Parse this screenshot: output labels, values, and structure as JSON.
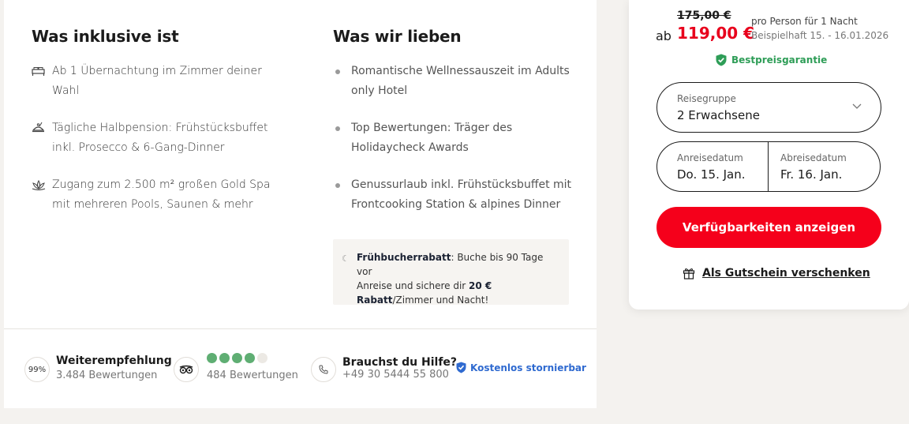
{
  "inclusive": {
    "title": "Was inklusive ist",
    "items": [
      {
        "icon": "bed-icon",
        "text_line1": "Ab 1 Übernachtung im Zimmer deiner",
        "text_line2": "Wahl"
      },
      {
        "icon": "dining-icon",
        "text_line1": "Tägliche Halbpension: Frühstücksbuffet",
        "text_line2": "inkl. Prosecco & 6-Gang-Dinner"
      },
      {
        "icon": "lotus-icon",
        "text_line1": "Zugang zum 2.500 m² großen Gold Spa",
        "text_line2": "mit mehreren Pools, Saunen & mehr"
      }
    ]
  },
  "love": {
    "title": "Was wir lieben",
    "items": [
      {
        "text_line1": "Romantische Wellnessauszeit im Adults",
        "text_line2": "only Hotel"
      },
      {
        "text_line1": "Top Bewertungen: Träger des",
        "text_line2": "Holidaycheck Awards"
      },
      {
        "text_line1": "Genussurlaub inkl. Frühstücksbuffet mit",
        "text_line2": "Frontcooking Station & alpines Dinner"
      }
    ]
  },
  "promo": {
    "bold_prefix": "Frühbucherrabatt",
    "text1": ": Buche bis 90 Tage vor",
    "text2": "Anreise und sichere dir",
    "amount": "20 €",
    "bold_rabatt": "Rabatt",
    "text3": "/Zimmer und Nacht!"
  },
  "ratings": {
    "recommend_badge": "99%",
    "recommend_title": "Weiterempfehlung",
    "recommend_sub": "3.484 Bewertungen",
    "tripadvisor_score": 4,
    "tripadvisor_max": 5,
    "tripadvisor_sub": "484 Bewertungen",
    "help_title": "Brauchst du Hilfe?",
    "help_phone": "+49 30 5444 55 800",
    "free_cancel": "Kostenlos stornierbar"
  },
  "booking": {
    "old_price": "175,00 €",
    "ab": "ab",
    "price": "119,00 €",
    "per_person": "pro Person für 1 Nacht",
    "example": "Beispielhaft 15. - 16.01.2026",
    "bestprice": "Bestpreisgarantie",
    "group_label": "Reisegruppe",
    "group_value": "2 Erwachsene",
    "arrival_label": "Anreisedatum",
    "arrival_value": "Do. 15. Jan.",
    "departure_label": "Abreisedatum",
    "departure_value": "Fr. 16. Jan.",
    "cta": "Verfügbarkeiten anzeigen",
    "gift": "Als Gutschein verschenken"
  },
  "colors": {
    "accent_red": "#f5001b",
    "price_red": "#e8001c",
    "green": "#2e9d57",
    "blue": "#2f6ad0",
    "star_green": "#5fae73"
  }
}
